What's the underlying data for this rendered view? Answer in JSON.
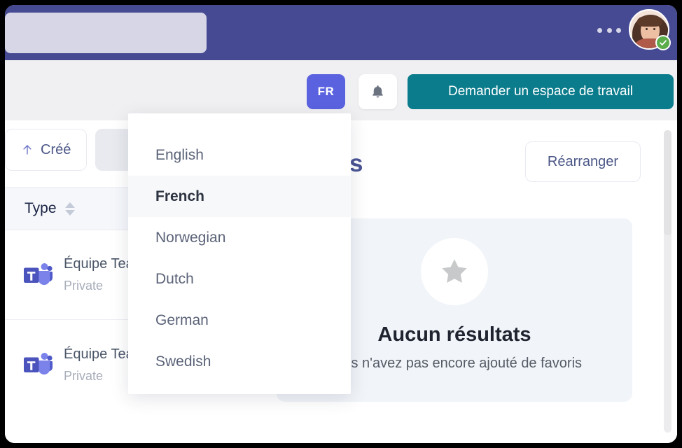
{
  "topbar": {
    "search_placeholder_block": "",
    "overflow_menu_label": "More options",
    "avatar_alt": "User avatar",
    "presence": "available"
  },
  "toolbar": {
    "language_code": "FR",
    "notifications_label": "Notifications",
    "request_workspace_label": "Demander un espace de travail"
  },
  "filters": {
    "created_label": "Créé",
    "secondary_label": ""
  },
  "table": {
    "columns": [
      "Type"
    ],
    "rows": [
      {
        "title": "Équipe Teams",
        "subtitle": "Private",
        "icon": "microsoft-teams-icon"
      },
      {
        "title": "Équipe Teams",
        "subtitle": "Private",
        "icon": "microsoft-teams-icon"
      }
    ]
  },
  "favorites": {
    "page_title": "Favoris",
    "rearrange_label": "Réarranger",
    "empty_icon": "star-icon",
    "empty_title": "Aucun résultats",
    "empty_subtitle": "Vous n'avez pas encore ajouté de favoris"
  },
  "language_dropdown": {
    "open": true,
    "selected": "French",
    "items": [
      {
        "label": "English"
      },
      {
        "label": "French"
      },
      {
        "label": "Norwegian"
      },
      {
        "label": "Dutch"
      },
      {
        "label": "German"
      },
      {
        "label": "Swedish"
      }
    ]
  },
  "colors": {
    "header_purple": "#454a93",
    "accent_indigo": "#5a62e0",
    "accent_teal": "#0b7c8c",
    "title_navy": "#4a5493",
    "presence_green": "#5aad4a"
  }
}
